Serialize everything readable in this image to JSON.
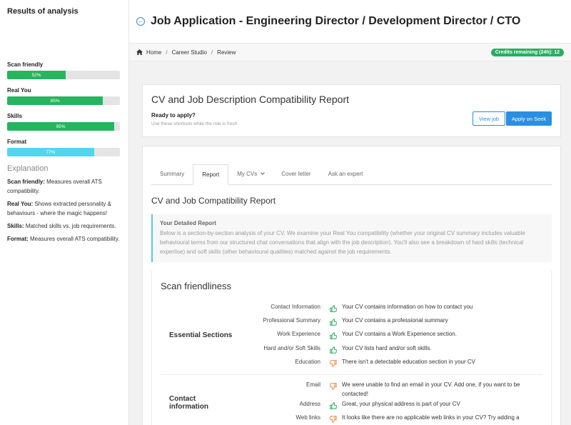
{
  "sidebar": {
    "title": "Results of analysis",
    "metrics": [
      {
        "label": "Scan friendly",
        "percent": "52%",
        "value": 52,
        "color": "#27b45f"
      },
      {
        "label": "Real You",
        "percent": "85%",
        "value": 85,
        "color": "#27b45f"
      },
      {
        "label": "Skills",
        "percent": "95%",
        "value": 95,
        "color": "#27b45f"
      },
      {
        "label": "Format",
        "percent": "77%",
        "value": 77,
        "color": "#55d4f2"
      }
    ],
    "explanation_title": "Explanation",
    "explanations": [
      {
        "term": "Scan friendly:",
        "text": " Measures overall ATS compatibility."
      },
      {
        "term": "Real You:",
        "text": " Shows extracted personality & behaviours - where the magic happens!"
      },
      {
        "term": "Skills:",
        "text": " Matched skills vs. job requirements."
      },
      {
        "term": "Format:",
        "text": " Measures overall ATS compatibility."
      }
    ]
  },
  "header": {
    "title": "Job Application - Engineering Director / Development Director / CTO"
  },
  "breadcrumb": [
    "Home",
    "Career Studio",
    "Review"
  ],
  "credits": "Credits remaining (24h): 12",
  "top_card": {
    "title": "CV and Job Description Compatibility Report",
    "ready": "Ready to apply?",
    "ready_sub": "Use these shortcuts while the role is fresh",
    "view_job": "View job",
    "apply": "Apply on Seek"
  },
  "tabs": [
    {
      "label": "Summary",
      "active": false
    },
    {
      "label": "Report",
      "active": true
    },
    {
      "label": "My CVs",
      "active": false
    },
    {
      "label": "Cover letter",
      "active": false
    },
    {
      "label": "Ask an expert",
      "active": false
    }
  ],
  "report": {
    "heading": "CV and Job Compatibility Report",
    "detail_title": "Your Detailed Report",
    "detail_text": "Below is a section-by-section analysis of your CV. We examine your Real You compatibility (whether your original CV summary includes valuable behavioural terms from our structured chat conversations that align with the job description). You'll also see a breakdown of hard skills (technical expertise) and soft skills (other behavioural qualities) matched against the job requirements."
  },
  "scan": {
    "title": "Scan friendliness",
    "groups": [
      {
        "name": "Essential Sections",
        "rows": [
          {
            "label": "Contact Information",
            "status": "good",
            "message": "Your CV contains information on how to contact you"
          },
          {
            "label": "Professional Summary",
            "status": "good",
            "message": "Your CV contains a professional summary"
          },
          {
            "label": "Work Experience",
            "status": "good",
            "message": "Your CV contains a Work Experience section."
          },
          {
            "label": "Hard and/or Soft Skills",
            "status": "good",
            "message": "Your CV lists hard and/or soft skills."
          },
          {
            "label": "Education",
            "status": "bad",
            "message": "There isn't a detectable education section in your CV"
          }
        ]
      },
      {
        "name": "Contact information",
        "rows": [
          {
            "label": "Email",
            "status": "bad",
            "message": "We were unable to find an email in your CV. Add one, if you want to be contacted!"
          },
          {
            "label": "Address",
            "status": "good",
            "message": "Great, your physical address is part of your CV"
          },
          {
            "label": "Web links",
            "status": "bad",
            "message": "It looks like there are no applicable web links in your CV? Try adding a"
          }
        ]
      }
    ]
  },
  "colors": {
    "accent": "#2a8fe0",
    "good": "#27ae60",
    "bad": "#f0874a"
  }
}
